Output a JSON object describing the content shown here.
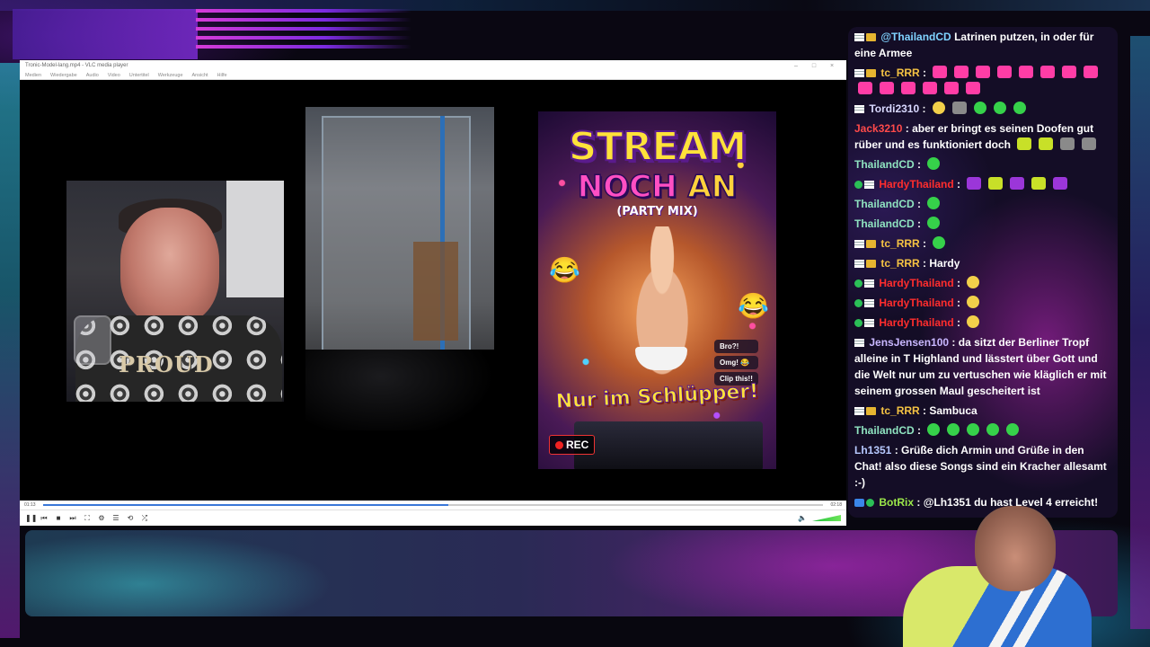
{
  "vlc": {
    "title": "Tronic-Model-lang.mp4 - VLC media player",
    "menu": [
      "Medien",
      "Wiedergabe",
      "Audio",
      "Video",
      "Untertitel",
      "Werkzeuge",
      "Ansicht",
      "Hilfe"
    ],
    "time_elapsed": "01:13",
    "time_total": "02:18",
    "progress": 0.52,
    "volume": "100%"
  },
  "cam1": {
    "shirt_text": "PROUD"
  },
  "poster": {
    "title_line1": "STREAM",
    "title_line2a": "NOCH ",
    "title_line2b": "AN",
    "subtitle": "(PARTY MIX)",
    "bubble1": "Bro?!",
    "bubble2": "Omg! 😂",
    "bubble3": "Clip this!!",
    "tagline": "Nur im Schlüpper!",
    "rec": "REC"
  },
  "chat": {
    "messages": [
      {
        "user": "",
        "text": "Latrinen putzen, in oder für eine Armee",
        "user_color": "#7fd3ff"
      },
      {
        "user": "tc_RRR",
        "text": "",
        "user_color": "#f5c343"
      },
      {
        "user": "Tordi2310",
        "text": "",
        "user_color": "#d9d9ff"
      },
      {
        "user": "Jack3210",
        "text": "aber er bringt es seinen Doofen gut rüber und es funktioniert doch",
        "user_color": "#ff4a4a"
      },
      {
        "user": "ThailandCD",
        "text": "",
        "user_color": "#8fe3c0"
      },
      {
        "user": "HardyThailand",
        "text": "",
        "user_color": "#ff2d2d"
      },
      {
        "user": "ThailandCD",
        "text": "",
        "user_color": "#8fe3c0"
      },
      {
        "user": "ThailandCD",
        "text": "",
        "user_color": "#8fe3c0"
      },
      {
        "user": "tc_RRR",
        "text": "",
        "user_color": "#f5c343"
      },
      {
        "user": "tc_RRR",
        "text": "Hardy",
        "user_color": "#f5c343"
      },
      {
        "user": "HardyThailand",
        "text": "",
        "user_color": "#ff2d2d"
      },
      {
        "user": "HardyThailand",
        "text": "",
        "user_color": "#ff2d2d"
      },
      {
        "user": "HardyThailand",
        "text": "",
        "user_color": "#ff2d2d"
      },
      {
        "user": "JensJensen100",
        "text": "da sitzt der Berliner Tropf alleine in T Highland und lässtert über Gott und die Welt nur um zu vertuschen wie kläglich er mit seinem grossen Maul gescheitert ist",
        "user_color": "#c9b8ff"
      },
      {
        "user": "tc_RRR",
        "text": "Sambuca",
        "user_color": "#f5c343"
      },
      {
        "user": "ThailandCD",
        "text": "",
        "user_color": "#8fe3c0"
      },
      {
        "user": "Lh1351",
        "text": "Grüße dich Armin und Grüße in den Chat! also diese Songs sind ein Kracher allesamt :-)",
        "user_color": "#b7c9ff"
      },
      {
        "user": "BotRix",
        "text": "@Lh1351 du hast Level 4 erreicht!",
        "user_color": "#9be84a"
      }
    ],
    "first_mention": "@ThailandCD"
  },
  "colors": {
    "accent_pink": "#d63bd8",
    "accent_teal": "#2a9db5",
    "vlc_progress": "#3a78d8"
  }
}
